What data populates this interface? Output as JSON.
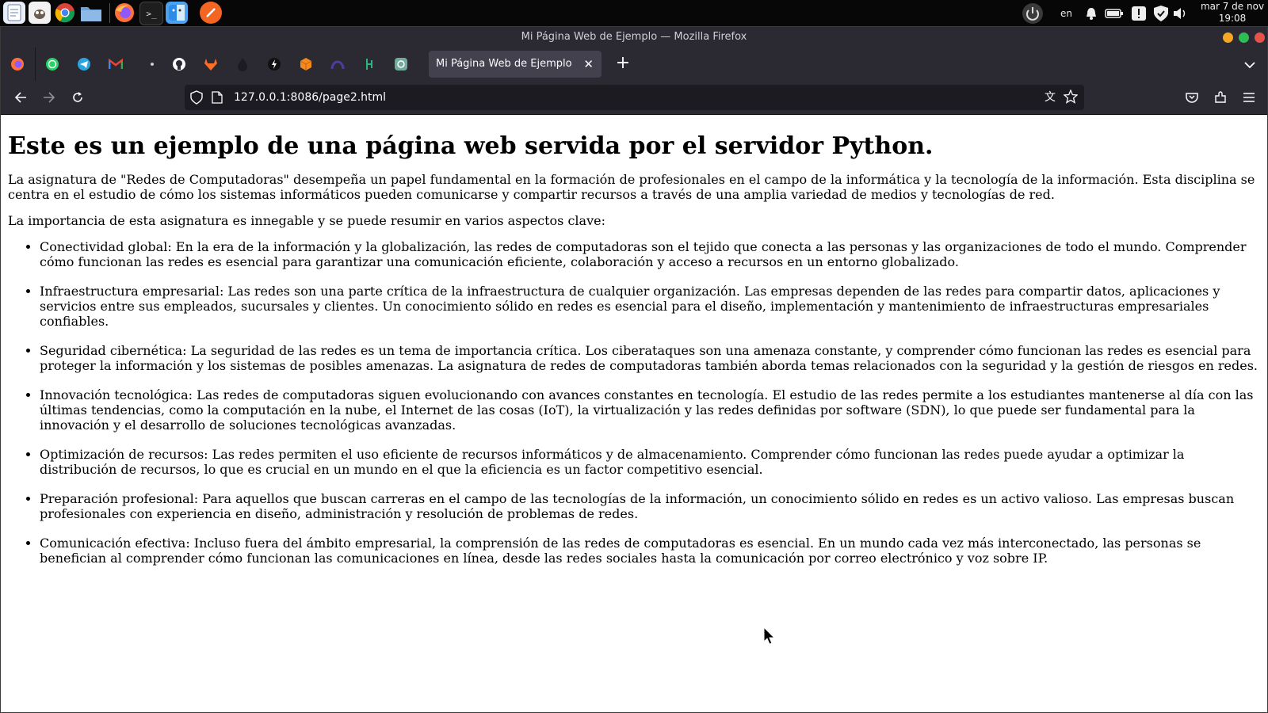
{
  "system": {
    "keyboard_layout": "en",
    "clock_date": "mar 7 de nov",
    "clock_time": "19:08"
  },
  "window": {
    "title": "Mi Página Web de Ejemplo — Mozilla Firefox"
  },
  "tab": {
    "title": "Mi Página Web de Ejemplo",
    "new_tab_symbol": "+"
  },
  "urlbar": {
    "url": "127.0.0.1:8086/page2.html"
  },
  "page": {
    "heading": "Este es un ejemplo de una página web servida por el servidor Python.",
    "intro": "La asignatura de \"Redes de Computadoras\" desempeña un papel fundamental en la formación de profesionales en el campo de la informática y la tecnología de la información. Esta disciplina se centra en el estudio de cómo los sistemas informáticos pueden comunicarse y compartir recursos a través de una amplia variedad de medios y tecnologías de red.",
    "lead": "La importancia de esta asignatura es innegable y se puede resumir en varios aspectos clave:",
    "items": [
      "Conectividad global: En la era de la información y la globalización, las redes de computadoras son el tejido que conecta a las personas y las organizaciones de todo el mundo. Comprender cómo funcionan las redes es esencial para garantizar una comunicación eficiente, colaboración y acceso a recursos en un entorno globalizado.",
      "Infraestructura empresarial: Las redes son una parte crítica de la infraestructura de cualquier organización. Las empresas dependen de las redes para compartir datos, aplicaciones y servicios entre sus empleados, sucursales y clientes. Un conocimiento sólido en redes es esencial para el diseño, implementación y mantenimiento de infraestructuras empresariales confiables.",
      "Seguridad cibernética: La seguridad de las redes es un tema de importancia crítica. Los ciberataques son una amenaza constante, y comprender cómo funcionan las redes es esencial para proteger la información y los sistemas de posibles amenazas. La asignatura de redes de computadoras también aborda temas relacionados con la seguridad y la gestión de riesgos en redes.",
      "Innovación tecnológica: Las redes de computadoras siguen evolucionando con avances constantes en tecnología. El estudio de las redes permite a los estudiantes mantenerse al día con las últimas tendencias, como la computación en la nube, el Internet de las cosas (IoT), la virtualización y las redes definidas por software (SDN), lo que puede ser fundamental para la innovación y el desarrollo de soluciones tecnológicas avanzadas.",
      "Optimización de recursos: Las redes permiten el uso eficiente de recursos informáticos y de almacenamiento. Comprender cómo funcionan las redes puede ayudar a optimizar la distribución de recursos, lo que es crucial en un mundo en el que la eficiencia es un factor competitivo esencial.",
      "Preparación profesional: Para aquellos que buscan carreras en el campo de las tecnologías de la información, un conocimiento sólido en redes es un activo valioso. Las empresas buscan profesionales con experiencia en diseño, administración y resolución de problemas de redes.",
      "Comunicación efectiva: Incluso fuera del ámbito empresarial, la comprensión de las redes de computadoras es esencial. En un mundo cada vez más interconectado, las personas se benefician al comprender cómo funcionan las comunicaciones en línea, desde las redes sociales hasta la comunicación por correo electrónico y voz sobre IP."
    ]
  },
  "colors": {
    "browser_chrome": "#2b2a33",
    "active_tab": "#42414d",
    "urlbar_bg": "#1c1b22",
    "window_close": "#e5534b",
    "window_maximize": "#2ebd52",
    "window_minimize": "#f5a623"
  },
  "icons": {
    "dock": [
      "text-editor-icon",
      "gimp-icon",
      "chrome-icon",
      "files-icon",
      "firefox-icon",
      "terminal-icon",
      "finder-icon",
      "app-icon"
    ],
    "pinned_tabs": [
      "firefox-icon",
      "whatsapp-icon",
      "telegram-icon",
      "gmail-icon",
      "dot-icon",
      "github-icon",
      "gitlab-icon",
      "fire-icon",
      "circle-bolt-icon",
      "cube-icon",
      "arc-icon",
      "bracket-icon",
      "chatgpt-icon"
    ]
  }
}
